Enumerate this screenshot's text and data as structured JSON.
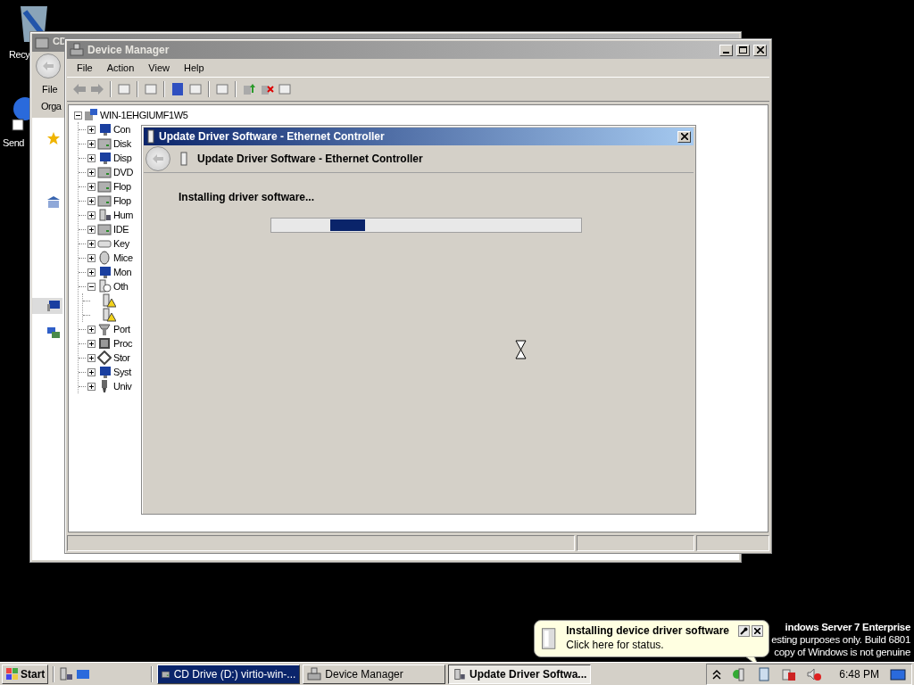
{
  "desktop_icons": [
    {
      "kind": "recycle",
      "label": "Recy"
    },
    {
      "kind": "shortcut",
      "label": "Send"
    }
  ],
  "explorer_window": {
    "title": "CD",
    "menu": [
      "File"
    ],
    "command": "Orga",
    "nav_items": [
      {
        "kind": "favorites",
        "selected": false
      },
      {
        "kind": "libraries",
        "selected": false
      },
      {
        "kind": "computer",
        "selected": true
      },
      {
        "kind": "network",
        "selected": false
      }
    ]
  },
  "device_manager": {
    "title": "Device Manager",
    "menu": [
      "File",
      "Action",
      "View",
      "Help"
    ],
    "tree": {
      "label": "WIN-1EHGIUMF1W5",
      "kind": "computer",
      "expanded": true,
      "children": [
        {
          "label": "Con",
          "kind": "monitor",
          "expanded": false
        },
        {
          "label": "Disk",
          "kind": "drive",
          "expanded": false
        },
        {
          "label": "Disp",
          "kind": "monitor",
          "expanded": false
        },
        {
          "label": "DVD",
          "kind": "drive",
          "expanded": false
        },
        {
          "label": "Flop",
          "kind": "drive",
          "expanded": false
        },
        {
          "label": "Flop",
          "kind": "drive",
          "expanded": false
        },
        {
          "label": "Hum",
          "kind": "device",
          "expanded": false
        },
        {
          "label": "IDE",
          "kind": "drive",
          "expanded": false
        },
        {
          "label": "Key",
          "kind": "keyboard",
          "expanded": false
        },
        {
          "label": "Mice",
          "kind": "mouse",
          "expanded": false
        },
        {
          "label": "Mon",
          "kind": "monitor",
          "expanded": false
        },
        {
          "label": "Oth",
          "kind": "unknown",
          "expanded": true,
          "children": [
            {
              "kind": "warning"
            },
            {
              "kind": "warning"
            }
          ]
        },
        {
          "label": "Port",
          "kind": "port",
          "expanded": false
        },
        {
          "label": "Proc",
          "kind": "chip",
          "expanded": false
        },
        {
          "label": "Stor",
          "kind": "storage",
          "expanded": false
        },
        {
          "label": "Syst",
          "kind": "monitor",
          "expanded": false
        },
        {
          "label": "Univ",
          "kind": "usb",
          "expanded": false
        }
      ]
    }
  },
  "dialog": {
    "title": "Update Driver Software - Ethernet Controller",
    "header": "Update Driver Software - Ethernet Controller",
    "message": "Installing driver software..."
  },
  "balloon": {
    "title": "Installing device driver software",
    "text": "Click here for status."
  },
  "desktop_notice": [
    "indows Server 7 Enterprise",
    "esting purposes only. Build 6801",
    "copy of Windows is not genuine"
  ],
  "taskbar": {
    "start": "Start",
    "tasks": [
      {
        "label": "CD Drive (D:) virtio-win-...",
        "kind": "drive",
        "selected": false,
        "flashing": true
      },
      {
        "label": "Device Manager",
        "kind": "manager",
        "selected": false,
        "flashing": false
      },
      {
        "label": "Update Driver Softwa...",
        "kind": "device",
        "selected": true,
        "flashing": false
      }
    ],
    "clock": "6:48 PM"
  }
}
